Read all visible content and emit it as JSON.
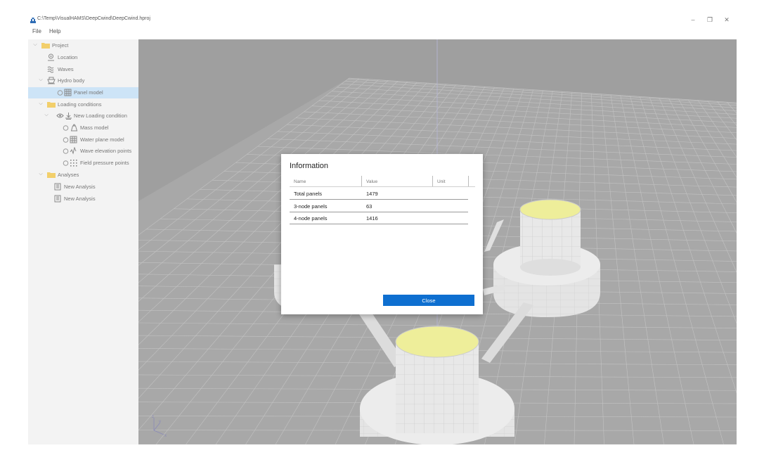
{
  "window": {
    "title": "C:\\Temp\\VisualHAMS\\DeepCwind\\DeepCwind.hproj",
    "app_icon": "hams-app-icon",
    "minimize_glyph": "–",
    "restore_glyph": "❐",
    "close_glyph": "✕"
  },
  "menu": {
    "file": "File",
    "help": "Help"
  },
  "tree": {
    "project": "Project",
    "location": "Location",
    "waves": "Waves",
    "hydro_body": "Hydro body",
    "panel_model": "Panel model",
    "loading_conditions": "Loading conditions",
    "new_loading_condition": "New Loading condition",
    "mass_model": "Mass model",
    "water_plane_model": "Water plane model",
    "wave_elevation_points": "Wave elevation points",
    "field_pressure_points": "Field pressure points",
    "analyses": "Analyses",
    "analysis_1": "New Analysis",
    "analysis_2": "New Analysis",
    "selected": "panel_model"
  },
  "dialog": {
    "title": "Information",
    "columns": {
      "name": "Name",
      "value": "Value",
      "unit": "Unit"
    },
    "rows": [
      {
        "name": "Total panels",
        "value": "1479",
        "unit": ""
      },
      {
        "name": "3-node panels",
        "value": "63",
        "unit": ""
      },
      {
        "name": "4-node panels",
        "value": "1416",
        "unit": ""
      }
    ],
    "close_label": "Close"
  },
  "axes": {
    "z": "z",
    "x": "x",
    "y": "y"
  },
  "colors": {
    "accent": "#0e6fd0",
    "selection": "#cde4f7",
    "viewport_bg": "#9f9f9f",
    "column_top": "#f0f0a8"
  }
}
